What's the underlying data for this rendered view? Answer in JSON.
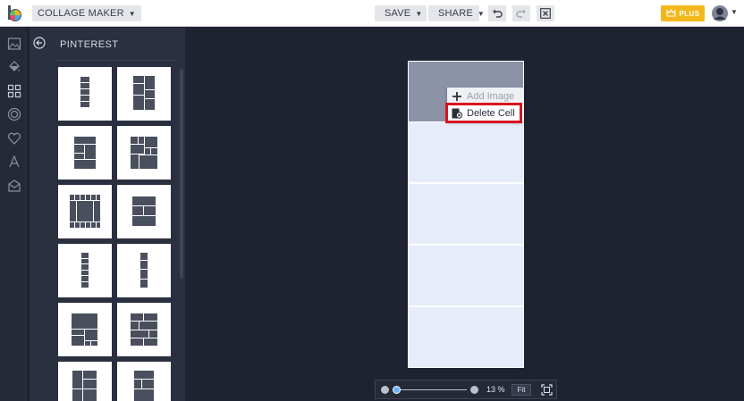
{
  "topbar": {
    "app_menu_label": "COLLAGE MAKER",
    "save_label": "SAVE",
    "share_label": "SHARE",
    "plus_label": "PLUS",
    "icons": [
      "logo-icon",
      "undo-icon",
      "redo-icon",
      "close-icon",
      "crown-icon",
      "avatar"
    ]
  },
  "rail": {
    "icons": [
      "image-icon",
      "paint-bucket-icon",
      "layout-grid-icon",
      "circle-icon",
      "heart-icon",
      "text-icon",
      "shape-icon"
    ]
  },
  "panel": {
    "title": "PINTEREST",
    "back_icon": "back-arrow-icon",
    "layout_count_visible": 12
  },
  "context_menu": {
    "add_image": "Add Image",
    "delete_cell": "Delete Cell"
  },
  "zoom": {
    "percent_label": "13 %",
    "fit_label": "Fit",
    "level": 0.13
  },
  "colors": {
    "background": "#1f2230",
    "panel": "#2b3040",
    "plus_button": "#f2b81b",
    "selected_cell": "#8c93a6",
    "empty_cell": "#e7ecfb",
    "highlight": "#d8141f"
  }
}
